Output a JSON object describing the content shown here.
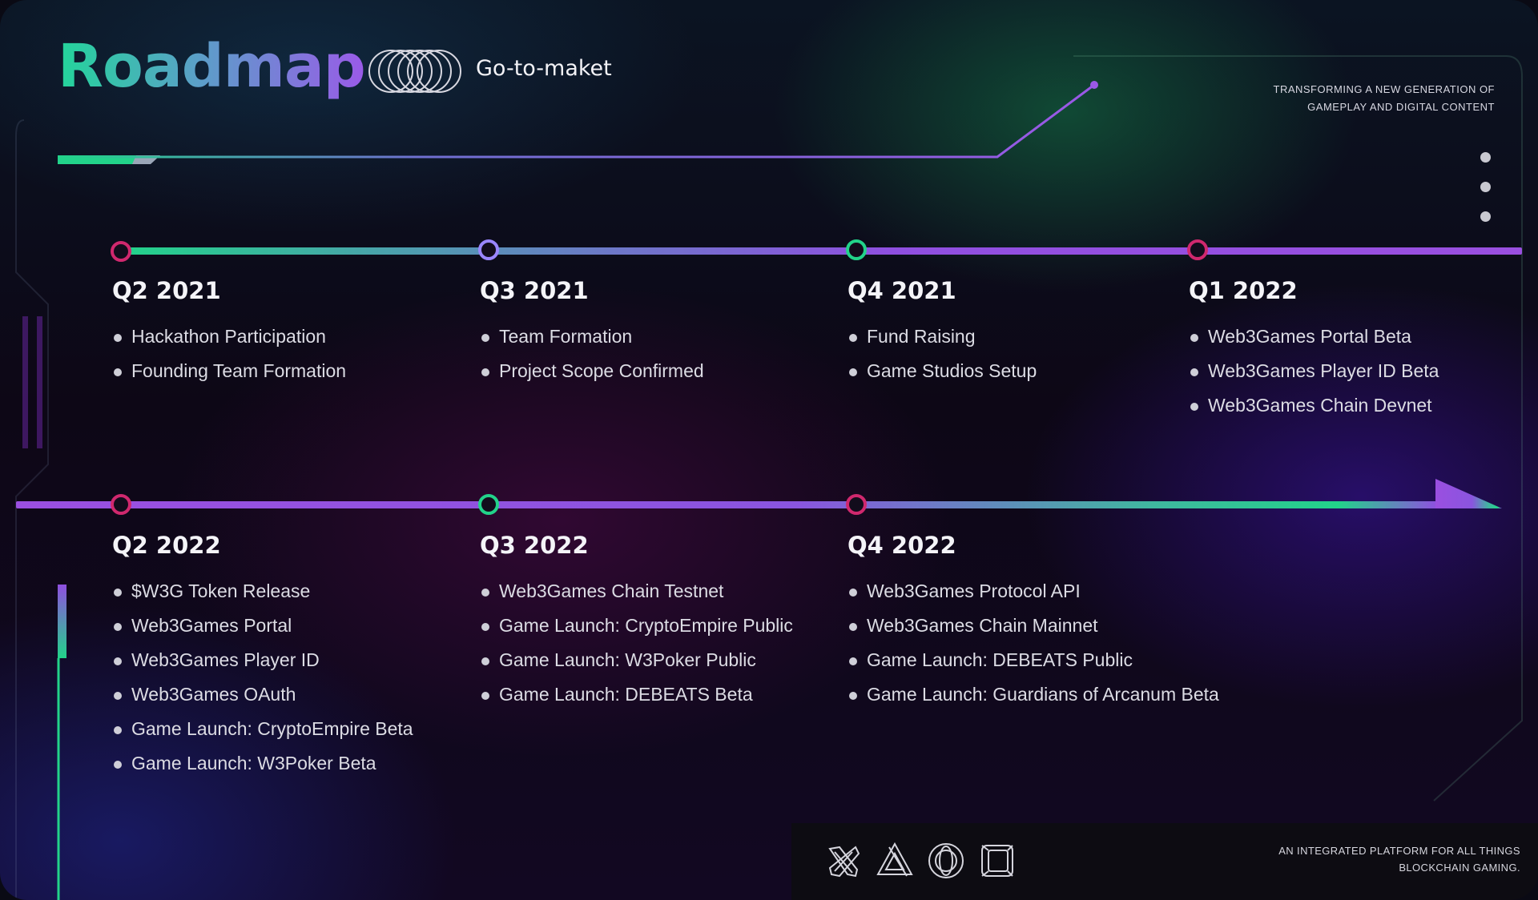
{
  "header": {
    "title": "Roadmap",
    "subtitle": "Go-to-maket",
    "tagline": "TRANSFORMING A NEW GENERATION OF GAMEPLAY AND DIGITAL CONTENT"
  },
  "colors": {
    "green": "#22d38a",
    "purple": "#8f4fe0",
    "pink": "#d0286e",
    "lavender": "#9a86ff"
  },
  "quarters": [
    {
      "label": "Q2 2021",
      "node_color": "#d0286e",
      "items": [
        "Hackathon Participation",
        "Founding Team Formation"
      ]
    },
    {
      "label": "Q3 2021",
      "node_color": "#9a86ff",
      "items": [
        "Team Formation",
        "Project Scope Confirmed"
      ]
    },
    {
      "label": "Q4 2021",
      "node_color": "#22d38a",
      "items": [
        "Fund Raising",
        "Game Studios Setup"
      ]
    },
    {
      "label": "Q1 2022",
      "node_color": "#d0286e",
      "items": [
        "Web3Games Portal Beta",
        "Web3Games Player ID Beta",
        "Web3Games Chain Devnet"
      ]
    },
    {
      "label": "Q2 2022",
      "node_color": "#d0286e",
      "items": [
        "$W3G Token Release",
        "Web3Games Portal",
        "Web3Games Player ID",
        "Web3Games OAuth",
        "Game Launch: CryptoEmpire Beta",
        "Game Launch: W3Poker Beta"
      ]
    },
    {
      "label": "Q3 2022",
      "node_color": "#22d38a",
      "items": [
        "Web3Games Chain Testnet",
        "Game Launch: CryptoEmpire Public",
        "Game Launch: W3Poker Public",
        "Game Launch: DEBEATS Beta"
      ]
    },
    {
      "label": "Q4 2022",
      "node_color": "#d0286e",
      "items": [
        "Web3Games Protocol API",
        "Web3Games Chain Mainnet",
        "Game Launch: DEBEATS Public",
        "Game Launch: Guardians of Arcanum Beta"
      ]
    }
  ],
  "footer": {
    "text": "AN INTEGRATED PLATFORM FOR ALL THINGS BLOCKCHAIN GAMING.",
    "icons": [
      "cross-logo-icon",
      "triangle-logo-icon",
      "ring-logo-icon",
      "cube-logo-icon"
    ]
  }
}
